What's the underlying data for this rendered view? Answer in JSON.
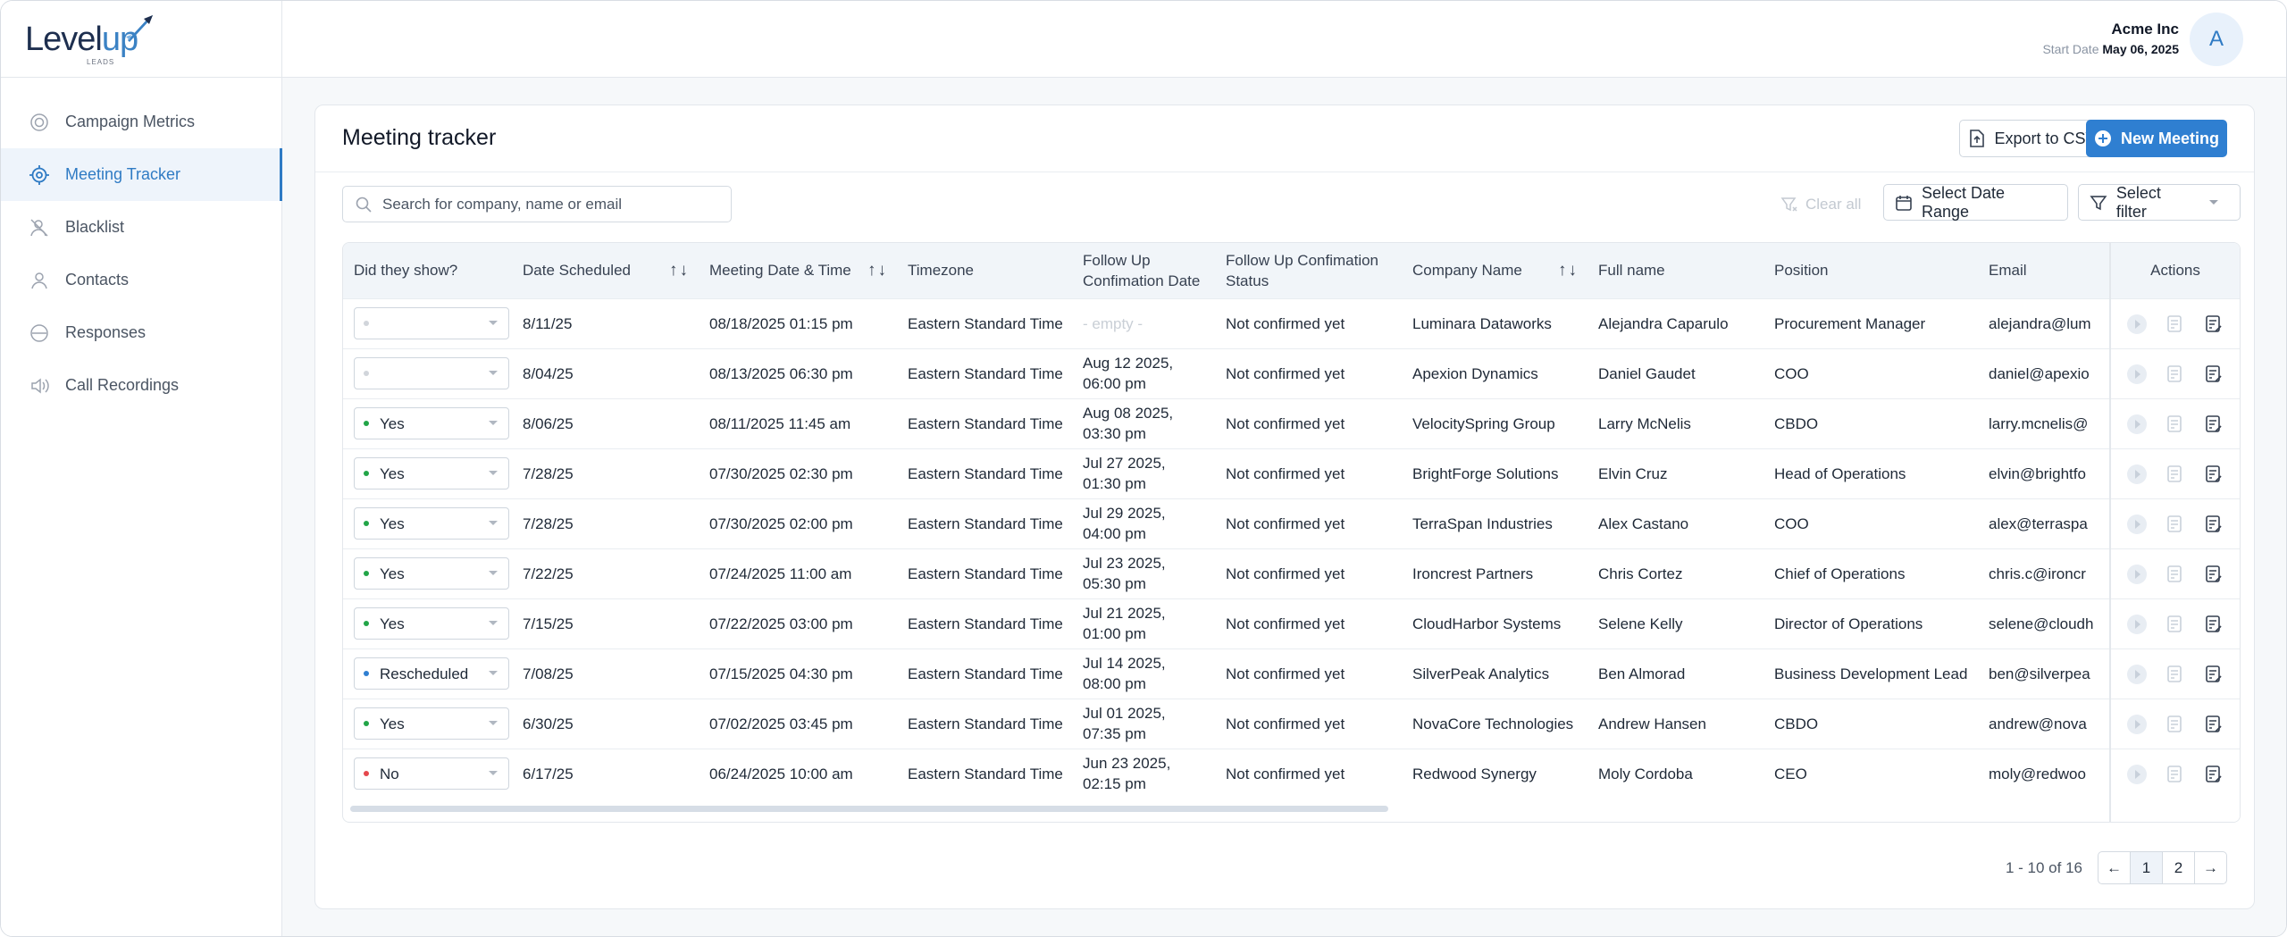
{
  "brand": {
    "logo_main": "Level",
    "logo_up": "up",
    "logo_sub": "LEADS"
  },
  "sidebar": {
    "items": [
      {
        "label": "Campaign Metrics",
        "icon": "target-icon"
      },
      {
        "label": "Meeting Tracker",
        "icon": "crosshair-icon",
        "active": true
      },
      {
        "label": "Blacklist",
        "icon": "blocked-user-icon"
      },
      {
        "label": "Contacts",
        "icon": "user-icon"
      },
      {
        "label": "Responses",
        "icon": "minus-circle-icon"
      },
      {
        "label": "Call Recordings",
        "icon": "speaker-icon"
      }
    ]
  },
  "header": {
    "company": "Acme Inc",
    "start_label": "Start Date",
    "start_date": "May 06, 2025",
    "avatar": "A"
  },
  "page": {
    "title": "Meeting tracker",
    "export_label": "Export to CSV",
    "new_label": "New Meeting",
    "search_placeholder": "Search for company, name or email",
    "clear_label": "Clear all",
    "date_range_label": "Select Date Range",
    "filter_label": "Select filter"
  },
  "table": {
    "columns": {
      "show": "Did they show?",
      "scheduled": "Date Scheduled",
      "meeting": "Meeting Date & Time",
      "tz": "Timezone",
      "fu_date": "Follow Up Confimation Date",
      "fu_status": "Follow Up  Confimation Status",
      "company": "Company Name",
      "name": "Full name",
      "position": "Position",
      "email": "Email",
      "actions": "Actions"
    },
    "sort_glyph": "↑↓",
    "rows": [
      {
        "show": "",
        "dot": "#d1d5db",
        "scheduled": "8/11/25",
        "meeting": "08/18/2025 01:15 pm",
        "tz": "Eastern Standard Time",
        "fu_date": "- empty -",
        "fu_empty": true,
        "fu_status": "Not confirmed yet",
        "company": "Luminara Dataworks",
        "name": "Alejandra Caparulo",
        "position": "Procurement Manager",
        "email": "alejandra@lum"
      },
      {
        "show": "",
        "dot": "#d1d5db",
        "scheduled": "8/04/25",
        "meeting": "08/13/2025 06:30 pm",
        "tz": "Eastern Standard Time",
        "fu_date": "Aug 12 2025, 06:00 pm",
        "fu_status": "Not confirmed yet",
        "company": "Apexion Dynamics",
        "name": "Daniel Gaudet",
        "position": "COO",
        "email": "daniel@apexio"
      },
      {
        "show": "Yes",
        "dot": "#22a547",
        "scheduled": "8/06/25",
        "meeting": "08/11/2025 11:45 am",
        "tz": "Eastern Standard Time",
        "fu_date": "Aug 08 2025, 03:30 pm",
        "fu_status": "Not confirmed yet",
        "company": "VelocitySpring Group",
        "name": "Larry McNelis",
        "position": "CBDO",
        "email": "larry.mcnelis@"
      },
      {
        "show": "Yes",
        "dot": "#22a547",
        "scheduled": "7/28/25",
        "meeting": "07/30/2025 02:30 pm",
        "tz": "Eastern Standard Time",
        "fu_date": "Jul 27 2025, 01:30 pm",
        "fu_status": "Not confirmed yet",
        "company": "BrightForge Solutions",
        "name": "Elvin Cruz",
        "position": "Head of Operations",
        "email": "elvin@brightfo"
      },
      {
        "show": "Yes",
        "dot": "#22a547",
        "scheduled": "7/28/25",
        "meeting": "07/30/2025 02:00 pm",
        "tz": "Eastern Standard Time",
        "fu_date": "Jul 29 2025, 04:00 pm",
        "fu_status": "Not confirmed yet",
        "company": "TerraSpan Industries",
        "name": "Alex Castano",
        "position": "COO",
        "email": "alex@terraspa"
      },
      {
        "show": "Yes",
        "dot": "#22a547",
        "scheduled": "7/22/25",
        "meeting": "07/24/2025 11:00 am",
        "tz": "Eastern Standard Time",
        "fu_date": "Jul 23 2025, 05:30 pm",
        "fu_status": "Not confirmed yet",
        "company": "Ironcrest Partners",
        "name": "Chris Cortez",
        "position": "Chief of Operations",
        "email": "chris.c@ironcr"
      },
      {
        "show": "Yes",
        "dot": "#22a547",
        "scheduled": "7/15/25",
        "meeting": "07/22/2025 03:00 pm",
        "tz": "Eastern Standard Time",
        "fu_date": "Jul 21 2025, 01:00 pm",
        "fu_status": "Not confirmed yet",
        "company": "CloudHarbor Systems",
        "name": "Selene Kelly",
        "position": "Director of Operations",
        "email": "selene@cloudh"
      },
      {
        "show": "Rescheduled",
        "dot": "#2f7fd1",
        "scheduled": "7/08/25",
        "meeting": "07/15/2025 04:30 pm",
        "tz": "Eastern Standard Time",
        "fu_date": "Jul 14 2025, 08:00 pm",
        "fu_status": "Not confirmed yet",
        "company": "SilverPeak Analytics",
        "name": "Ben Almorad",
        "position": "Business Development Lead",
        "email": "ben@silverpea"
      },
      {
        "show": "Yes",
        "dot": "#22a547",
        "scheduled": "6/30/25",
        "meeting": "07/02/2025 03:45 pm",
        "tz": "Eastern Standard Time",
        "fu_date": "Jul 01 2025, 07:35 pm",
        "fu_status": "Not confirmed yet",
        "company": "NovaCore Technologies",
        "name": "Andrew Hansen",
        "position": "CBDO",
        "email": "andrew@nova"
      },
      {
        "show": "No",
        "dot": "#e5484d",
        "scheduled": "6/17/25",
        "meeting": "06/24/2025 10:00 am",
        "tz": "Eastern Standard Time",
        "fu_date": "Jun 23 2025, 02:15 pm",
        "fu_status": "Not confirmed yet",
        "company": "Redwood Synergy",
        "name": "Moly Cordoba",
        "position": "CEO",
        "email": "moly@redwoo"
      }
    ]
  },
  "pagination": {
    "range": "1 - 10 of 16",
    "prev": "←",
    "next": "→",
    "pages": [
      "1",
      "2"
    ],
    "current": "1"
  }
}
